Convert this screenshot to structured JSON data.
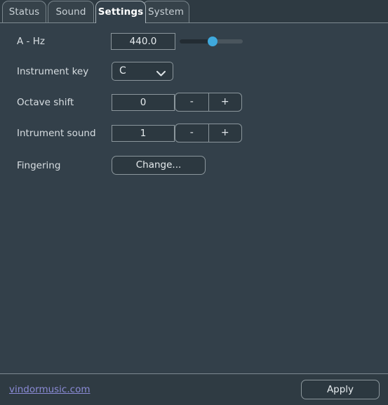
{
  "window": {
    "background_color": "#33404a",
    "accent_color": "#3fa9dd",
    "link_color": "#8b8bd6",
    "border_color": "#8b969c"
  },
  "tabs": [
    {
      "label": "Status",
      "active": false
    },
    {
      "label": "Sound",
      "active": false
    },
    {
      "label": "Settings",
      "active": true
    },
    {
      "label": "System",
      "active": false
    }
  ],
  "settings": {
    "a_hz": {
      "label": "A - Hz",
      "value": "440.0",
      "slider": {
        "percent": 52,
        "min": 0,
        "max": 100
      }
    },
    "instrument_key": {
      "label": "Instrument key",
      "value": "C",
      "chevron_icon": "chevron-down-icon",
      "options": [
        "C"
      ]
    },
    "octave_shift": {
      "label": "Octave shift",
      "value": "0",
      "minus_label": "-",
      "plus_label": "+"
    },
    "instrument_sound": {
      "label": "Intrument sound",
      "value": "1",
      "minus_label": "-",
      "plus_label": "+"
    },
    "fingering": {
      "label": "Fingering",
      "button_label": "Change..."
    }
  },
  "footer": {
    "link_text": "vindormusic.com",
    "apply_label": "Apply"
  }
}
